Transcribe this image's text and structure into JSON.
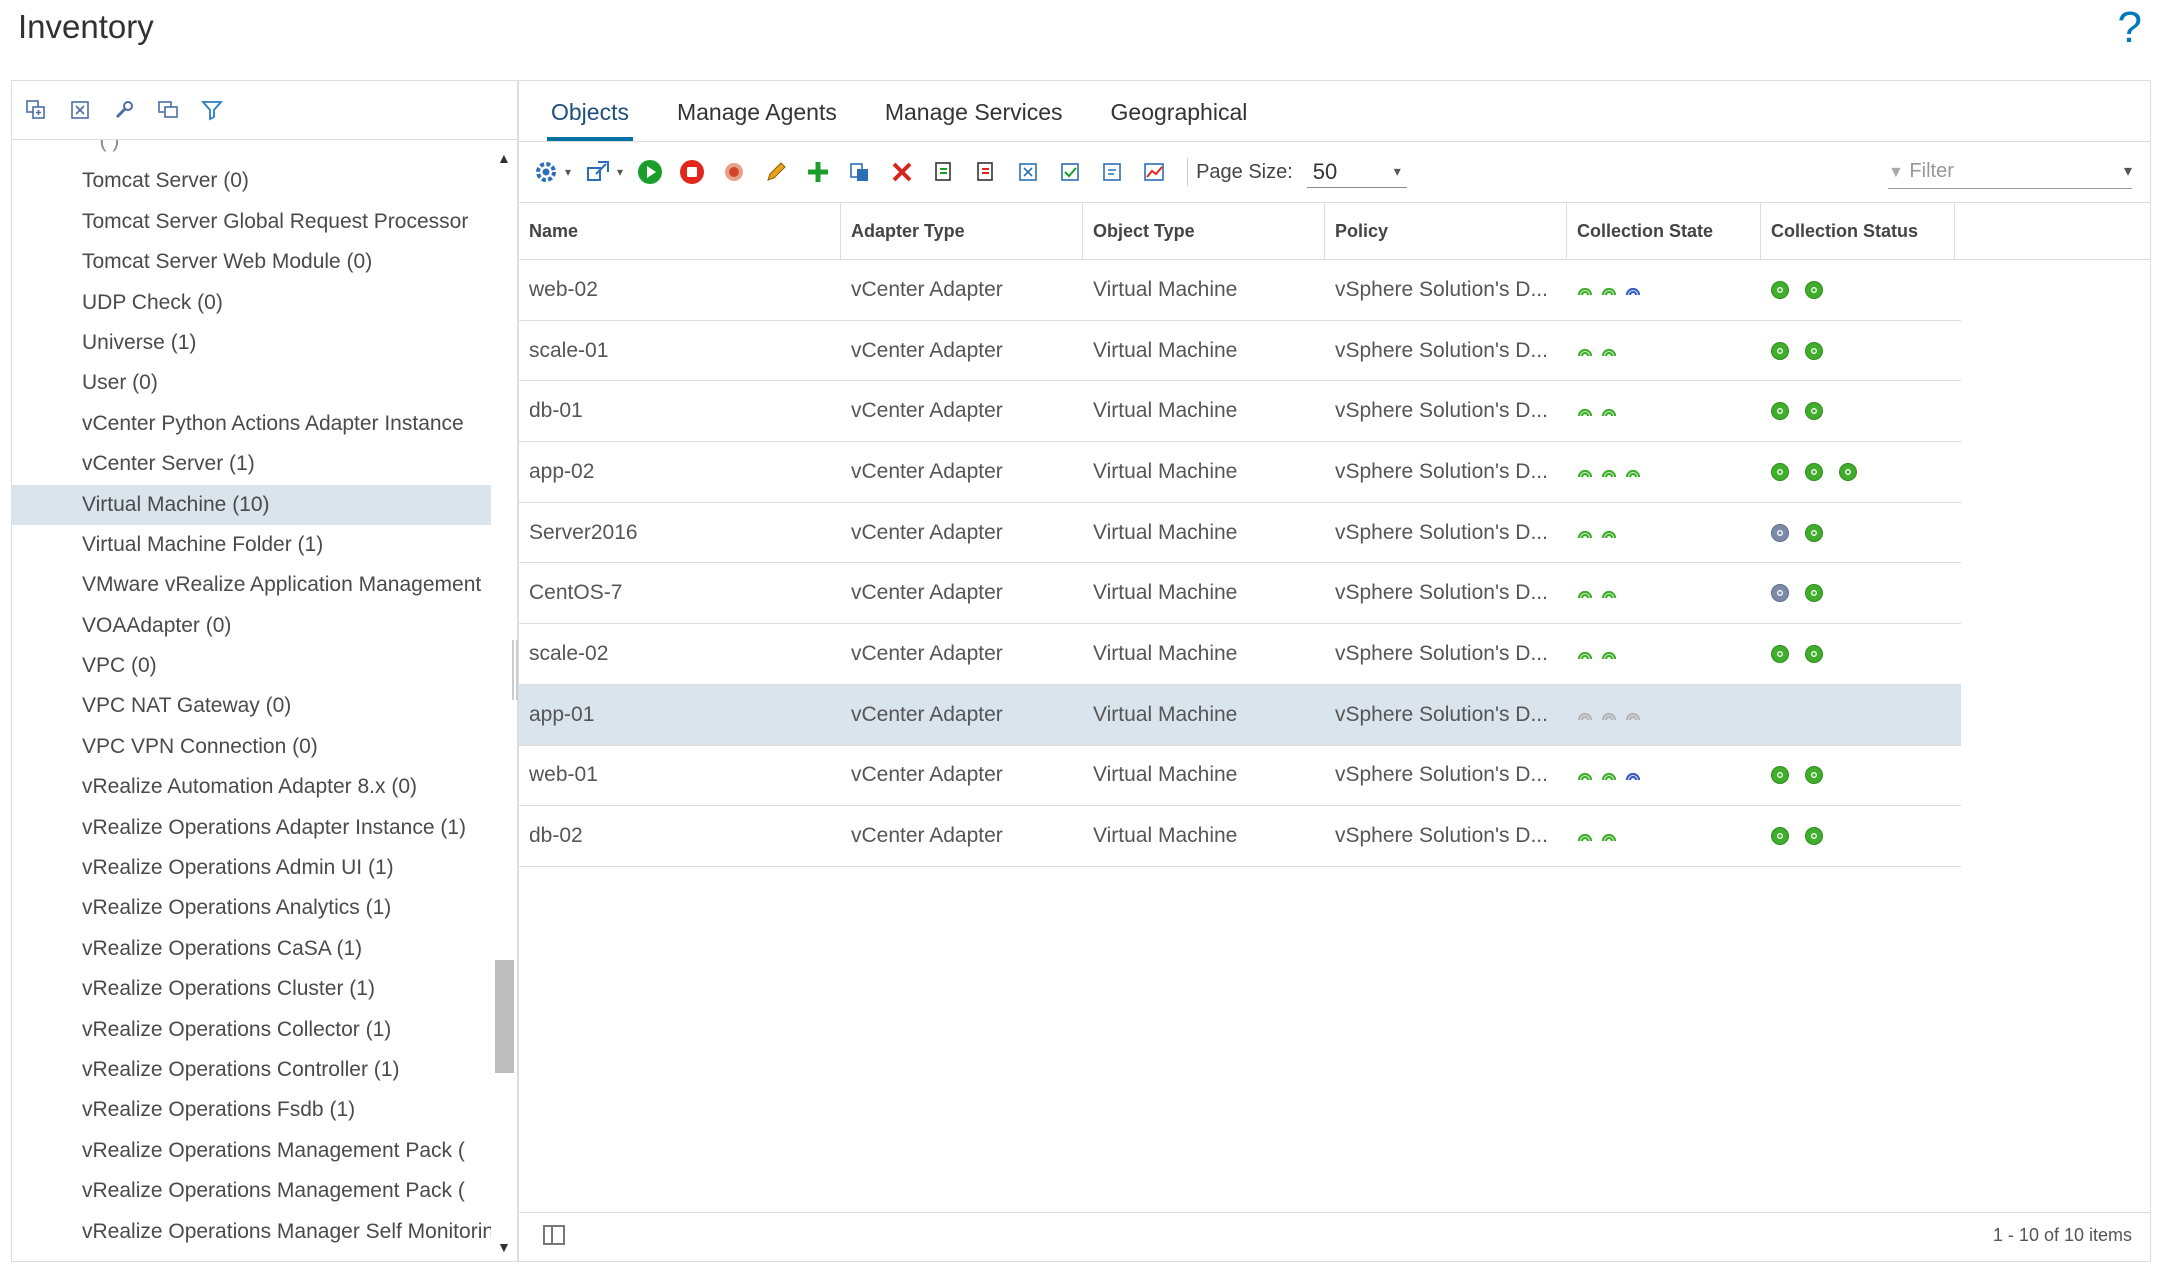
{
  "header": {
    "title": "Inventory",
    "help_glyph": "?"
  },
  "colors": {
    "accent": "#0072a3",
    "selected_row": "#d9e4ed",
    "ok_green": "#3fae2a",
    "unknown_gray": "#7a8aa8",
    "blue_state": "#3b5fc6"
  },
  "left_toolbar": {
    "icons": [
      "expand-all-icon",
      "collapse-all-icon",
      "wrench-icon",
      "copy-icon",
      "filter-icon"
    ]
  },
  "tree": {
    "items": [
      {
        "label": "Tomcat Server (0)"
      },
      {
        "label": "Tomcat Server Global Request Processor"
      },
      {
        "label": "Tomcat Server Web Module (0)"
      },
      {
        "label": "UDP Check (0)"
      },
      {
        "label": "Universe (1)"
      },
      {
        "label": "User (0)"
      },
      {
        "label": "vCenter Python Actions Adapter Instance"
      },
      {
        "label": "vCenter Server (1)"
      },
      {
        "label": "Virtual Machine (10)",
        "selected": true
      },
      {
        "label": "Virtual Machine Folder (1)"
      },
      {
        "label": "VMware vRealize Application Management"
      },
      {
        "label": "VOAAdapter (0)"
      },
      {
        "label": "VPC (0)"
      },
      {
        "label": "VPC NAT Gateway (0)"
      },
      {
        "label": "VPC VPN Connection (0)"
      },
      {
        "label": "vRealize Automation Adapter 8.x (0)"
      },
      {
        "label": "vRealize Operations Adapter Instance (1)"
      },
      {
        "label": "vRealize Operations Admin UI (1)"
      },
      {
        "label": "vRealize Operations Analytics (1)"
      },
      {
        "label": "vRealize Operations CaSA (1)"
      },
      {
        "label": "vRealize Operations Cluster (1)"
      },
      {
        "label": "vRealize Operations Collector (1)"
      },
      {
        "label": "vRealize Operations Controller (1)"
      },
      {
        "label": "vRealize Operations Fsdb (1)"
      },
      {
        "label": "vRealize Operations Management Pack ("
      },
      {
        "label": "vRealize Operations Management Pack ("
      },
      {
        "label": "vRealize Operations Manager Self Monitoring"
      }
    ]
  },
  "tabs": [
    {
      "label": "Objects",
      "active": true
    },
    {
      "label": "Manage Agents"
    },
    {
      "label": "Manage Services"
    },
    {
      "label": "Geographical"
    }
  ],
  "toolbar": {
    "page_size_label": "Page Size:",
    "page_size_value": "50",
    "filter_placeholder": "Filter"
  },
  "grid": {
    "columns": [
      "Name",
      "Adapter Type",
      "Object Type",
      "Policy",
      "Collection State",
      "Collection Status"
    ],
    "rows": [
      {
        "name": "web-02",
        "adapter": "vCenter Adapter",
        "otype": "Virtual Machine",
        "policy": "vSphere Solution's D...",
        "state": [
          "green",
          "green",
          "blue"
        ],
        "status": [
          "green",
          "green"
        ]
      },
      {
        "name": "scale-01",
        "adapter": "vCenter Adapter",
        "otype": "Virtual Machine",
        "policy": "vSphere Solution's D...",
        "state": [
          "green",
          "green"
        ],
        "status": [
          "green",
          "green"
        ]
      },
      {
        "name": "db-01",
        "adapter": "vCenter Adapter",
        "otype": "Virtual Machine",
        "policy": "vSphere Solution's D...",
        "state": [
          "green",
          "green"
        ],
        "status": [
          "green",
          "green"
        ]
      },
      {
        "name": "app-02",
        "adapter": "vCenter Adapter",
        "otype": "Virtual Machine",
        "policy": "vSphere Solution's D...",
        "state": [
          "green",
          "green",
          "green"
        ],
        "status": [
          "green",
          "green",
          "green"
        ]
      },
      {
        "name": "Server2016",
        "adapter": "vCenter Adapter",
        "otype": "Virtual Machine",
        "policy": "vSphere Solution's D...",
        "state": [
          "green",
          "green"
        ],
        "status": [
          "gray",
          "green"
        ]
      },
      {
        "name": "CentOS-7",
        "adapter": "vCenter Adapter",
        "otype": "Virtual Machine",
        "policy": "vSphere Solution's D...",
        "state": [
          "green",
          "green"
        ],
        "status": [
          "gray",
          "green"
        ]
      },
      {
        "name": "scale-02",
        "adapter": "vCenter Adapter",
        "otype": "Virtual Machine",
        "policy": "vSphere Solution's D...",
        "state": [
          "green",
          "green"
        ],
        "status": [
          "green",
          "green"
        ]
      },
      {
        "name": "app-01",
        "adapter": "vCenter Adapter",
        "otype": "Virtual Machine",
        "policy": "vSphere Solution's D...",
        "state": [
          "gray",
          "gray",
          "gray"
        ],
        "status": [],
        "selected": true
      },
      {
        "name": "web-01",
        "adapter": "vCenter Adapter",
        "otype": "Virtual Machine",
        "policy": "vSphere Solution's D...",
        "state": [
          "green",
          "green",
          "blue"
        ],
        "status": [
          "green",
          "green"
        ]
      },
      {
        "name": "db-02",
        "adapter": "vCenter Adapter",
        "otype": "Virtual Machine",
        "policy": "vSphere Solution's D...",
        "state": [
          "green",
          "green"
        ],
        "status": [
          "green",
          "green"
        ]
      }
    ]
  },
  "footer": {
    "pagination": "1 - 10 of 10 items"
  }
}
